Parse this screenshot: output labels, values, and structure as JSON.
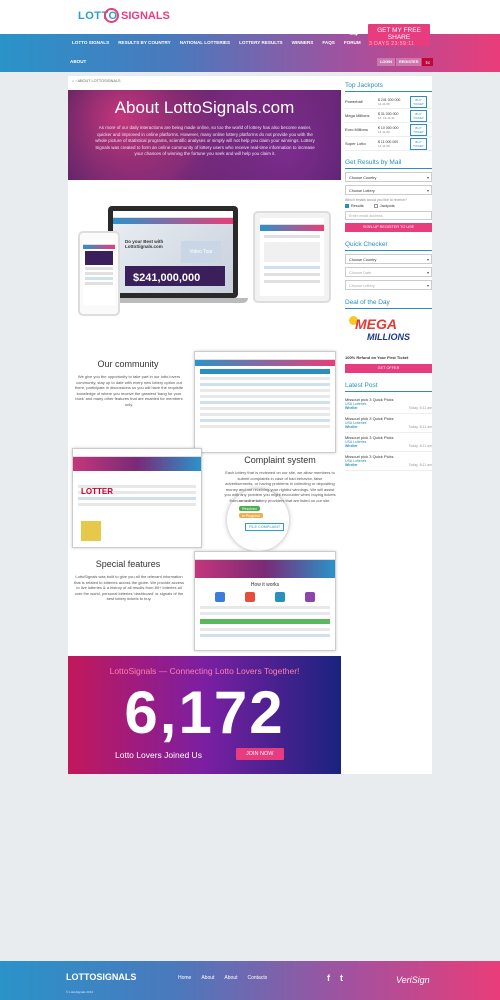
{
  "header": {
    "logo_left": "LOTTO",
    "logo_right": "SIGNALS",
    "nav": [
      "LOTTO SIGNALS",
      "RESULTS BY COUNTRY",
      "NATIONAL LOTTERIES",
      "LOTTERY RESULTS",
      "WINNERS",
      "FAQS",
      "FORUM"
    ],
    "nav_about": "ABOUT",
    "jackpot_label": "SHARED JACKPOT",
    "free_share": "GET MY FREE SHARE",
    "timer": "3 DAYS 23:59:11",
    "login": "LOGIN",
    "register": "REGISTER"
  },
  "breadcrumb": "› ABOUT LOTTOSIGNALS",
  "hero": {
    "title": "About LottoSignals.com",
    "text": "As more of our daily interactions are being made online, so too the world of lottery has also become easier, quicker and improved in online platforms. However, many online lottery platforms do not provide you with the whole picture of statistical programs, scientific analyses or simply will not help you claim your winnings. Lottery Signals was created to form an online community of lottery users who receive real-time information to increase your chances of winning the fortune you seek and will help you claim it."
  },
  "devices": {
    "best_with": "Do your Best with LottoSignals.com",
    "video": "Video Tour",
    "amount": "$241,000,000"
  },
  "community": {
    "title": "Our community",
    "text": "We give you the opportunity to take part in our lotto lovers community, stay up to date with every new lottery option out there, participate in discussions so you will have the requisite knowledge of where you receive the greatest 'bang for your buck' and many other features that are enabled for members only."
  },
  "complaint": {
    "title": "Complaint system",
    "text": "Each lottery that is reviewed on our site, we allow members to submit complaints in case of bad behavior, false advertisements, or having problems in collecting or depositing money and not receiving your rightful winnings. We will assist you with any problem you might encounter when buying tickets from an online lottery providers that are listed on our site.",
    "resolved": "Resolved",
    "in_progress": "In Progress",
    "button": "FILE COMPLAINT",
    "header_small": "LOTTERY SITES"
  },
  "special": {
    "title": "Special features",
    "text": "LottoSignals was built to give you all the relevant information that is related to lotteries across the globe. We provide access to live lotteries & a history of all results from 80+ lotteries all over the world, personal lotteries 'dashboard' or signals of the best lottery tickets to buy.",
    "how_it_works": "How it works"
  },
  "connect": {
    "tagline": "LottoSignals — Connecting Lotto Lovers Together!",
    "count": "6,172",
    "joined": "Lotto Lovers Joined Us",
    "join_button": "JOIN NOW"
  },
  "sidebar": {
    "top_jackpots_title": "Top Jackpots",
    "jackpots": [
      {
        "name": "Powerball",
        "amount": "$ 241 000 000",
        "date": "14-11-06",
        "btn": "BUY TICKET"
      },
      {
        "name": "Mega Millions",
        "amount": "$ 31 000 000",
        "date": "14, 19-11-11",
        "btn": "BUY TICKET"
      },
      {
        "name": "Euro Millions",
        "amount": "€ 10 000 000",
        "date": "14-11-06",
        "btn": "BUY TICKET"
      },
      {
        "name": "Super Lotto",
        "amount": "$ 11 000 000",
        "date": "14-11-06",
        "btn": "BUY TICKET"
      }
    ],
    "mail_title": "Get Results by Mail",
    "choose_country": "Choose Country",
    "choose_lottery": "Choose Lottery",
    "which_emails": "Which emails would you like to receive?",
    "results": "Results",
    "jackpots_opt": "Jackpots",
    "email_placeholder": "Enter email address",
    "signup_button": "SIGN-UP REGISTER TO USE",
    "quick_title": "Quick Checker",
    "qc_country": "Choose Country",
    "qc_date": "Choose Date",
    "qc_lottery": "Choose Lottery",
    "deal_title": "Deal of the Day",
    "mega_top": "MEGA",
    "mega_bottom": "MILLIONS",
    "refund": "100% Refund on Your First Ticket",
    "get_offer": "GET OFFER",
    "latest_title": "Latest Post",
    "posts": [
      {
        "title": "Missouri pick 3 Quick Picks",
        "cat": "USA Lotteries",
        "author": "Wheller",
        "time": "Today, 8:11 am"
      },
      {
        "title": "Missouri pick 3 Quick Picks",
        "cat": "USA Lotteries",
        "author": "Wheller",
        "time": "Today, 8:11 am"
      },
      {
        "title": "Missouri pick 3 Quick Picks",
        "cat": "USA Lotteries",
        "author": "Wheller",
        "time": "Today, 8:11 am"
      },
      {
        "title": "Missouri pick 3 Quick Picks",
        "cat": "USA Lotteries",
        "author": "Wheller",
        "time": "Today, 8:11 am"
      }
    ]
  },
  "footer": {
    "logo": "LOTTOSIGNALS",
    "copy": "© LottoSignals 2014",
    "links": [
      "Home",
      "About",
      "About",
      "Contacts"
    ],
    "verisign": "VeriSign"
  }
}
